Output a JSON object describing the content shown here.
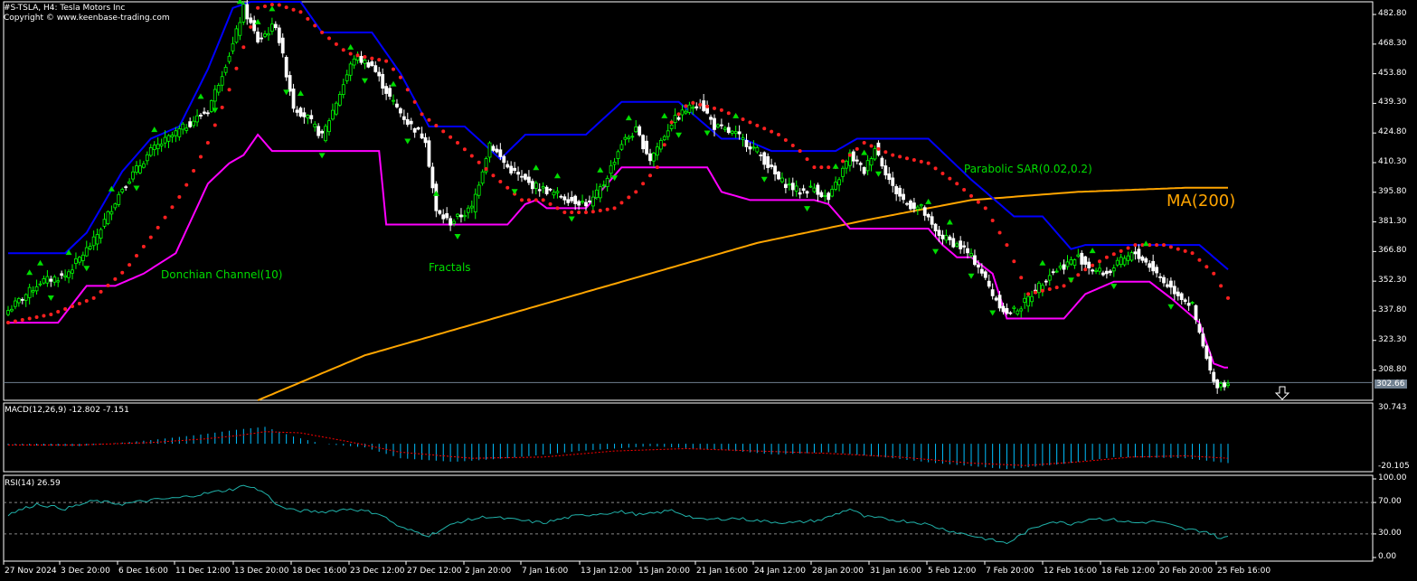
{
  "header": {
    "symbol_line": "#S-TSLA, H4:  Tesla Motors Inc",
    "copyright_line": "Copyright © www.keenbase-trading.com"
  },
  "annotations": {
    "donchian": "Donchian Channel(10)",
    "fractals": "Fractals",
    "sar": "Parabolic SAR(0.02,0.2)",
    "ma": "MA(200)"
  },
  "colors": {
    "background": "#000000",
    "axis": "#ffffff",
    "candle_up": "#00ff00",
    "candle_down": "#ffffff",
    "donchian_upper": "#0000ff",
    "donchian_lower": "#ff00ff",
    "sar": "#ff2020",
    "ma": "#ffa500",
    "fractal": "#00dd00",
    "label_green": "#00dd00",
    "label_orange": "#ffa500",
    "macd_hist": "#00bfff",
    "macd_signal": "#ff0000",
    "rsi": "#20b2aa",
    "current_price_line": "#708090"
  },
  "panels": {
    "price": {
      "current_price_label": "302.66",
      "axis_labels": [
        "482.80",
        "468.30",
        "453.80",
        "439.30",
        "424.80",
        "410.30",
        "395.80",
        "381.30",
        "366.80",
        "352.30",
        "337.80",
        "323.30",
        "308.80"
      ]
    },
    "macd": {
      "title": "MACD(12,26,9) -12.802 -7.151",
      "axis_labels": [
        "30.743",
        "-20.105"
      ]
    },
    "rsi": {
      "title": "RSI(14) 26.59",
      "axis_labels": [
        "100.00",
        "70.00",
        "30.00",
        "0.00"
      ]
    }
  },
  "time_axis": [
    "27 Nov 2024",
    "3 Dec 20:00",
    "6 Dec 16:00",
    "11 Dec 12:00",
    "13 Dec 20:00",
    "18 Dec 16:00",
    "23 Dec 12:00",
    "27 Dec 12:00",
    "2 Jan 20:00",
    "7 Jan 16:00",
    "13 Jan 12:00",
    "15 Jan 20:00",
    "21 Jan 16:00",
    "24 Jan 12:00",
    "28 Jan 20:00",
    "31 Jan 16:00",
    "5 Feb 12:00",
    "7 Feb 20:00",
    "12 Feb 16:00",
    "18 Feb 12:00",
    "20 Feb 20:00",
    "25 Feb 16:00"
  ],
  "chart_data": {
    "type": "candlestick",
    "price_range": [
      294,
      489
    ],
    "close_anchors": [
      [
        0,
        338
      ],
      [
        9,
        352
      ],
      [
        16,
        355
      ],
      [
        24,
        372
      ],
      [
        32,
        398
      ],
      [
        40,
        416
      ],
      [
        48,
        426
      ],
      [
        56,
        436
      ],
      [
        63,
        468
      ],
      [
        66,
        486
      ],
      [
        70,
        470
      ],
      [
        75,
        478
      ],
      [
        80,
        438
      ],
      [
        84,
        432
      ],
      [
        88,
        423
      ],
      [
        92,
        440
      ],
      [
        97,
        462
      ],
      [
        102,
        458
      ],
      [
        107,
        442
      ],
      [
        112,
        430
      ],
      [
        117,
        422
      ],
      [
        120,
        386
      ],
      [
        124,
        381
      ],
      [
        130,
        388
      ],
      [
        135,
        420
      ],
      [
        140,
        408
      ],
      [
        146,
        400
      ],
      [
        152,
        396
      ],
      [
        158,
        392
      ],
      [
        163,
        390
      ],
      [
        167,
        400
      ],
      [
        172,
        420
      ],
      [
        176,
        426
      ],
      [
        180,
        412
      ],
      [
        186,
        430
      ],
      [
        190,
        436
      ],
      [
        194,
        440
      ],
      [
        198,
        428
      ],
      [
        204,
        424
      ],
      [
        210,
        416
      ],
      [
        216,
        402
      ],
      [
        222,
        396
      ],
      [
        226,
        398
      ],
      [
        230,
        392
      ],
      [
        236,
        414
      ],
      [
        240,
        406
      ],
      [
        243,
        418
      ],
      [
        248,
        398
      ],
      [
        252,
        390
      ],
      [
        256,
        388
      ],
      [
        260,
        376
      ],
      [
        264,
        372
      ],
      [
        268,
        368
      ],
      [
        272,
        360
      ],
      [
        276,
        346
      ],
      [
        280,
        336
      ],
      [
        284,
        340
      ],
      [
        288,
        348
      ],
      [
        292,
        356
      ],
      [
        296,
        360
      ],
      [
        300,
        364
      ],
      [
        304,
        358
      ],
      [
        308,
        356
      ],
      [
        312,
        362
      ],
      [
        316,
        366
      ],
      [
        320,
        360
      ],
      [
        324,
        352
      ],
      [
        328,
        346
      ],
      [
        332,
        340
      ],
      [
        334,
        326
      ],
      [
        336,
        314
      ],
      [
        338,
        302
      ]
    ],
    "donchian_upper": [
      [
        0,
        366
      ],
      [
        16,
        366
      ],
      [
        22,
        376
      ],
      [
        32,
        406
      ],
      [
        40,
        422
      ],
      [
        48,
        428
      ],
      [
        56,
        456
      ],
      [
        63,
        486
      ],
      [
        68,
        489
      ],
      [
        82,
        489
      ],
      [
        88,
        474
      ],
      [
        102,
        474
      ],
      [
        110,
        454
      ],
      [
        118,
        428
      ],
      [
        128,
        428
      ],
      [
        138,
        412
      ],
      [
        145,
        424
      ],
      [
        162,
        424
      ],
      [
        172,
        440
      ],
      [
        188,
        440
      ],
      [
        200,
        422
      ],
      [
        206,
        422
      ],
      [
        214,
        416
      ],
      [
        232,
        416
      ],
      [
        238,
        422
      ],
      [
        258,
        422
      ],
      [
        270,
        402
      ],
      [
        282,
        384
      ],
      [
        290,
        384
      ],
      [
        298,
        368
      ],
      [
        302,
        370
      ],
      [
        316,
        370
      ],
      [
        334,
        370
      ],
      [
        342,
        358
      ]
    ],
    "donchian_lower": [
      [
        0,
        332
      ],
      [
        14,
        332
      ],
      [
        22,
        350
      ],
      [
        30,
        350
      ],
      [
        38,
        356
      ],
      [
        47,
        366
      ],
      [
        56,
        400
      ],
      [
        62,
        410
      ],
      [
        66,
        414
      ],
      [
        70,
        424
      ],
      [
        74,
        416
      ],
      [
        86,
        416
      ],
      [
        104,
        416
      ],
      [
        106,
        380
      ],
      [
        140,
        380
      ],
      [
        145,
        390
      ],
      [
        148,
        392
      ],
      [
        151,
        388
      ],
      [
        162,
        388
      ],
      [
        172,
        408
      ],
      [
        196,
        408
      ],
      [
        200,
        396
      ],
      [
        204,
        394
      ],
      [
        208,
        392
      ],
      [
        226,
        392
      ],
      [
        230,
        390
      ],
      [
        236,
        378
      ],
      [
        258,
        378
      ],
      [
        262,
        370
      ],
      [
        266,
        364
      ],
      [
        270,
        364
      ],
      [
        276,
        356
      ],
      [
        280,
        334
      ],
      [
        296,
        334
      ],
      [
        302,
        346
      ],
      [
        310,
        352
      ],
      [
        320,
        352
      ],
      [
        326,
        344
      ],
      [
        334,
        332
      ],
      [
        338,
        312
      ],
      [
        341,
        310
      ]
    ],
    "sar": [
      [
        0,
        332
      ],
      [
        12,
        336
      ],
      [
        24,
        344
      ],
      [
        33,
        358
      ],
      [
        41,
        376
      ],
      [
        49,
        396
      ],
      [
        56,
        420
      ],
      [
        62,
        446
      ],
      [
        67,
        472
      ],
      [
        70,
        486
      ],
      [
        75,
        488
      ],
      [
        82,
        484
      ],
      [
        88,
        474
      ],
      [
        95,
        464
      ],
      [
        100,
        462
      ],
      [
        106,
        460
      ],
      [
        110,
        452
      ],
      [
        116,
        434
      ],
      [
        126,
        420
      ],
      [
        136,
        404
      ],
      [
        144,
        392
      ],
      [
        150,
        392
      ],
      [
        156,
        386
      ],
      [
        163,
        386
      ],
      [
        170,
        388
      ],
      [
        176,
        396
      ],
      [
        182,
        408
      ],
      [
        186,
        430
      ],
      [
        191,
        440
      ],
      [
        200,
        436
      ],
      [
        208,
        430
      ],
      [
        216,
        424
      ],
      [
        222,
        416
      ],
      [
        226,
        408
      ],
      [
        232,
        408
      ],
      [
        240,
        420
      ],
      [
        248,
        414
      ],
      [
        258,
        410
      ],
      [
        266,
        400
      ],
      [
        274,
        388
      ],
      [
        280,
        370
      ],
      [
        286,
        346
      ],
      [
        296,
        350
      ],
      [
        302,
        358
      ],
      [
        308,
        364
      ],
      [
        316,
        370
      ],
      [
        324,
        370
      ],
      [
        332,
        366
      ],
      [
        338,
        356
      ],
      [
        342,
        344
      ]
    ],
    "ma200": [
      [
        70,
        294
      ],
      [
        100,
        316
      ],
      [
        140,
        336
      ],
      [
        180,
        356
      ],
      [
        210,
        371
      ],
      [
        240,
        382
      ],
      [
        270,
        392
      ],
      [
        300,
        396
      ],
      [
        330,
        398
      ],
      [
        342,
        398
      ]
    ],
    "fractals_up": [
      6,
      9,
      17,
      29,
      41,
      54,
      65,
      70,
      74,
      82,
      96,
      108,
      120,
      148,
      154,
      166,
      174,
      184,
      204,
      232,
      240,
      258,
      264,
      290,
      304,
      319
    ],
    "fractals_down": [
      12,
      22,
      36,
      58,
      78,
      88,
      100,
      112,
      126,
      142,
      158,
      170,
      188,
      196,
      212,
      224,
      244,
      260,
      270,
      276,
      298,
      310,
      326
    ],
    "macd_anchors": [
      [
        0,
        -1
      ],
      [
        20,
        -2
      ],
      [
        40,
        3
      ],
      [
        55,
        8
      ],
      [
        65,
        12
      ],
      [
        72,
        14
      ],
      [
        80,
        6
      ],
      [
        88,
        0
      ],
      [
        100,
        -3
      ],
      [
        110,
        -12
      ],
      [
        125,
        -15
      ],
      [
        140,
        -12
      ],
      [
        160,
        -6
      ],
      [
        180,
        -2
      ],
      [
        200,
        -5
      ],
      [
        215,
        -9
      ],
      [
        230,
        -7
      ],
      [
        245,
        -11
      ],
      [
        260,
        -16
      ],
      [
        280,
        -21
      ],
      [
        295,
        -17
      ],
      [
        310,
        -11
      ],
      [
        330,
        -12
      ],
      [
        342,
        -16
      ]
    ],
    "signal_anchors": [
      [
        0,
        -1
      ],
      [
        20,
        -1
      ],
      [
        40,
        1
      ],
      [
        55,
        4
      ],
      [
        65,
        7
      ],
      [
        72,
        10
      ],
      [
        82,
        9
      ],
      [
        95,
        2
      ],
      [
        110,
        -7
      ],
      [
        130,
        -12
      ],
      [
        150,
        -11
      ],
      [
        170,
        -6
      ],
      [
        190,
        -4
      ],
      [
        210,
        -6
      ],
      [
        230,
        -8
      ],
      [
        250,
        -11
      ],
      [
        270,
        -16
      ],
      [
        285,
        -18
      ],
      [
        300,
        -15
      ],
      [
        315,
        -11
      ],
      [
        330,
        -10
      ],
      [
        342,
        -12
      ]
    ],
    "macd_range": [
      -20.105,
      30.743
    ],
    "rsi_anchors": [
      [
        0,
        55
      ],
      [
        8,
        68
      ],
      [
        16,
        62
      ],
      [
        24,
        72
      ],
      [
        32,
        68
      ],
      [
        40,
        73
      ],
      [
        48,
        76
      ],
      [
        56,
        82
      ],
      [
        63,
        87
      ],
      [
        67,
        92
      ],
      [
        72,
        82
      ],
      [
        76,
        65
      ],
      [
        80,
        60
      ],
      [
        88,
        58
      ],
      [
        96,
        62
      ],
      [
        104,
        56
      ],
      [
        110,
        38
      ],
      [
        118,
        28
      ],
      [
        126,
        45
      ],
      [
        134,
        52
      ],
      [
        142,
        48
      ],
      [
        150,
        44
      ],
      [
        158,
        52
      ],
      [
        166,
        56
      ],
      [
        172,
        58
      ],
      [
        178,
        54
      ],
      [
        186,
        60
      ],
      [
        194,
        48
      ],
      [
        204,
        50
      ],
      [
        212,
        46
      ],
      [
        220,
        44
      ],
      [
        228,
        48
      ],
      [
        236,
        62
      ],
      [
        240,
        52
      ],
      [
        248,
        48
      ],
      [
        256,
        44
      ],
      [
        264,
        34
      ],
      [
        272,
        26
      ],
      [
        280,
        18
      ],
      [
        286,
        34
      ],
      [
        292,
        46
      ],
      [
        298,
        43
      ],
      [
        304,
        50
      ],
      [
        310,
        48
      ],
      [
        316,
        44
      ],
      [
        322,
        46
      ],
      [
        330,
        36
      ],
      [
        336,
        33
      ],
      [
        340,
        24
      ],
      [
        342,
        26
      ]
    ],
    "rsi_levels": [
      70,
      30
    ],
    "bars": 343,
    "arrow": "down"
  }
}
